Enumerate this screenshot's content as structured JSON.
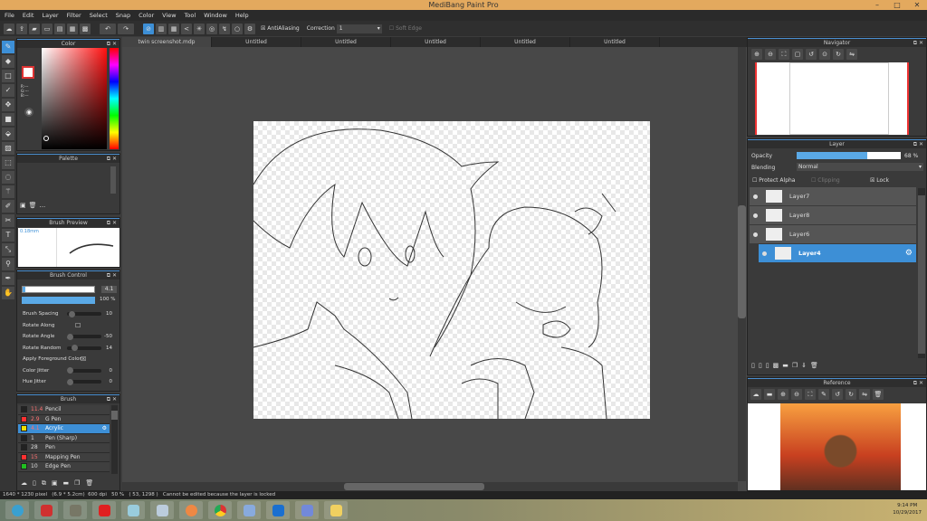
{
  "app": {
    "title": "MediBang Paint Pro"
  },
  "menu": [
    "File",
    "Edit",
    "Layer",
    "Filter",
    "Select",
    "Snap",
    "Color",
    "View",
    "Tool",
    "Window",
    "Help"
  ],
  "toolbar": {
    "antialiasing": "AntiAliasing",
    "correction_label": "Correction",
    "correction_value": "1",
    "soft_edge": "Soft Edge"
  },
  "tabs": [
    "twin screenshot.mdp",
    "Untitled",
    "Untitled",
    "Untitled",
    "Untitled",
    "Untitled"
  ],
  "color_panel": {
    "title": "Color",
    "r": "R:---",
    "g": "G:---",
    "b": "B:---"
  },
  "palette": {
    "title": "Palette",
    "more": "..."
  },
  "brush_preview": {
    "title": "Brush Preview",
    "size": "0.18mm"
  },
  "brush_control": {
    "title": "Brush Control",
    "size_value": "4.1",
    "opacity_value": "100 %",
    "size_fraction": 0.04,
    "opacity_fraction": 1.0,
    "rows": [
      {
        "label": "Brush Spacing",
        "value": "10"
      },
      {
        "label": "Rotate Along",
        "value": ""
      },
      {
        "label": "Rotate Angle",
        "value": "-50"
      },
      {
        "label": "Rotate Random",
        "value": "14"
      },
      {
        "label": "Apply Foreground Color",
        "value": ""
      },
      {
        "label": "Color Jitter",
        "value": "0"
      },
      {
        "label": "Hue Jitter",
        "value": "0"
      }
    ]
  },
  "brush": {
    "title": "Brush",
    "items": [
      {
        "size": "11.4",
        "name": "Pencil",
        "color": "#222222"
      },
      {
        "size": "2.9",
        "name": "G Pen",
        "color": "#ff3030"
      },
      {
        "size": "4.1",
        "name": "Acrylic",
        "color": "#f0e000",
        "selected": true
      },
      {
        "size": "1",
        "name": "Pen (Sharp)",
        "color": "#222222"
      },
      {
        "size": "28",
        "name": "Pen",
        "color": "#222222"
      },
      {
        "size": "15",
        "name": "Mapping Pen",
        "color": "#ff3030"
      },
      {
        "size": "10",
        "name": "Edge Pen",
        "color": "#20c020"
      }
    ]
  },
  "navigator": {
    "title": "Navigator"
  },
  "layer_panel": {
    "title": "Layer",
    "opacity_label": "Opacity",
    "opacity_value": "68 %",
    "opacity_fraction": 0.68,
    "blending_label": "Blending",
    "blending_value": "Normal",
    "protect_alpha": "Protect Alpha",
    "clipping": "Clipping",
    "lock": "Lock",
    "layers": [
      {
        "name": "Layer7"
      },
      {
        "name": "Layer8"
      },
      {
        "name": "Layer6"
      },
      {
        "name": "Layer4",
        "selected": true
      }
    ]
  },
  "reference": {
    "title": "Reference"
  },
  "status": {
    "text": "1640 * 1230 pixel   (6.9 * 5.2cm)  600 dpi   50 %   ( 53, 1298 )   Cannot be edited because the layer is locked"
  },
  "clock": {
    "time": "9:14 PM",
    "date": "10/29/2017"
  },
  "colors": {
    "accent": "#3d8fd6",
    "titlebar": "#e3a95e"
  }
}
